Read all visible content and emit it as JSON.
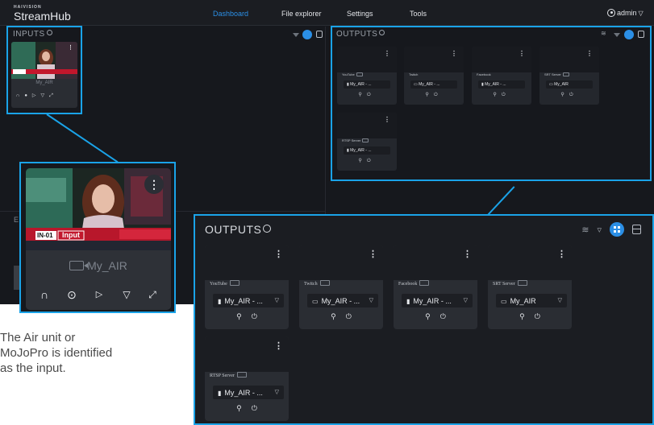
{
  "app": {
    "brand_small": "HAIVISION",
    "brand_name": "StreamHub",
    "tabs": [
      {
        "label": "Dashboard",
        "active": true
      },
      {
        "label": "File explorer",
        "active": false
      },
      {
        "label": "Settings",
        "active": false
      },
      {
        "label": "Tools",
        "active": false
      }
    ],
    "user": "admin",
    "inputs_title": "INPUTS",
    "outputs_title": "OUTPUTS",
    "accent_color": "#2b8fe6",
    "callout_color": "#1aa3e8"
  },
  "input_card": {
    "name": "My_AIR",
    "badge": "IN-01",
    "overlay": "Input",
    "controls": [
      "headphones-icon",
      "record-icon",
      "play-icon",
      "dropdown-icon",
      "expand-icon"
    ]
  },
  "outputs": [
    {
      "type": "YouTube",
      "source": "My_AIR - ...",
      "source_icon": "file-icon"
    },
    {
      "type": "Twitch",
      "source": "My_AIR - ...",
      "source_icon": "camera-icon"
    },
    {
      "type": "Facebook",
      "source": "My_AIR - ...",
      "source_icon": "file-icon"
    },
    {
      "type": "SRT Server",
      "source": "My_AIR",
      "source_icon": "camera-icon"
    },
    {
      "type": "RTSP Server",
      "source": "My_AIR - ...",
      "source_icon": "file-icon"
    }
  ],
  "zoom_outputs_title": "OUTPUTS",
  "caption": {
    "line1": "The Air unit or",
    "line2": "MoJoPro is identified",
    "line3": "as the input."
  }
}
